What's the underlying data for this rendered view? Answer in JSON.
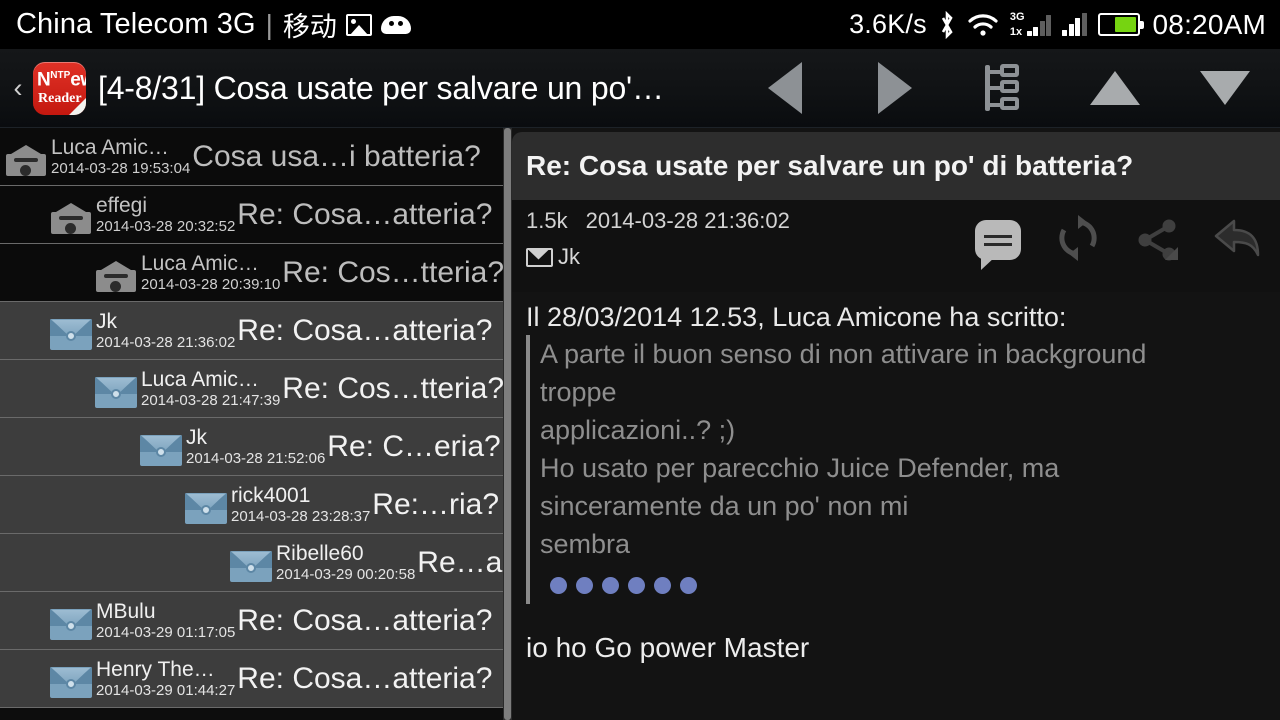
{
  "statusbar": {
    "carrier": "China Telecom 3G",
    "separator": "|",
    "carrier_cn": "移动",
    "picture_icon": "picture-icon",
    "android_icon": "android-icon",
    "speed": "3.6K/s",
    "bluetooth_icon": "bluetooth-icon",
    "wifi_icon": "wifi-icon",
    "net_label_top": "3G",
    "net_label_bottom": "1x",
    "signal_icon": "signal-bars-icon",
    "battery_icon": "battery-icon",
    "time": "08:20AM"
  },
  "actionbar": {
    "back_glyph": "‹",
    "logo": {
      "name": "nntp-news-reader-logo",
      "line1": "N",
      "line1_sup": "NTP",
      "line1_rest": "ews",
      "line2": "Reader"
    },
    "title": "[4-8/31] Cosa usate per salvare un po'…",
    "actions": [
      {
        "name": "previous-message-button",
        "icon": "triangle-left-icon"
      },
      {
        "name": "next-message-button",
        "icon": "triangle-right-icon"
      },
      {
        "name": "thread-tree-button",
        "icon": "thread-tree-icon"
      },
      {
        "name": "scroll-up-button",
        "icon": "triangle-up-icon"
      },
      {
        "name": "scroll-down-button",
        "icon": "triangle-down-icon"
      }
    ]
  },
  "list": {
    "rows": [
      {
        "author": "Luca Amic…",
        "date": "2014-03-28 19:53:04",
        "subject": "Cosa usa…i batteria?",
        "indent": 0,
        "read": true
      },
      {
        "author": "effegi",
        "date": "2014-03-28 20:32:52",
        "subject": "Re: Cosa…atteria?",
        "indent": 1,
        "read": true
      },
      {
        "author": "Luca Amic…",
        "date": "2014-03-28 20:39:10",
        "subject": "Re: Cos…tteria?",
        "indent": 2,
        "read": true
      },
      {
        "author": "Jk",
        "date": "2014-03-28 21:36:02",
        "subject": "Re: Cosa…atteria?",
        "indent": 1,
        "read": false
      },
      {
        "author": "Luca Amic…",
        "date": "2014-03-28 21:47:39",
        "subject": "Re: Cos…tteria?",
        "indent": 2,
        "read": false
      },
      {
        "author": "Jk",
        "date": "2014-03-28 21:52:06",
        "subject": "Re: C…eria?",
        "indent": 3,
        "read": false
      },
      {
        "author": "rick4001",
        "date": "2014-03-28 23:28:37",
        "subject": "Re:…ria?",
        "indent": 4,
        "read": false
      },
      {
        "author": "Ribelle60",
        "date": "2014-03-29 00:20:58",
        "subject": "Re…a?",
        "indent": 5,
        "read": false
      },
      {
        "author": "MBulu",
        "date": "2014-03-29 01:17:05",
        "subject": "Re: Cosa…atteria?",
        "indent": 1,
        "read": false
      },
      {
        "author": "Henry The…",
        "date": "2014-03-29 01:44:27",
        "subject": "Re: Cosa…atteria?",
        "indent": 1,
        "read": false
      }
    ]
  },
  "message": {
    "subject": "Re: Cosa usate per salvare un po' di batteria?",
    "size": "1.5k",
    "date": "2014-03-28 21:36:02",
    "from": "Jk",
    "from_icon": "envelope-icon",
    "actions": [
      {
        "name": "comment-button",
        "icon": "comment-bubble-icon"
      },
      {
        "name": "refresh-button",
        "icon": "refresh-icon"
      },
      {
        "name": "share-button",
        "icon": "share-icon"
      },
      {
        "name": "reply-button",
        "icon": "reply-arrow-icon"
      }
    ],
    "attribution": "Il 28/03/2014 12.53, Luca Amicone ha scritto:",
    "quote_lines": [
      "A parte il buon senso di non attivare in background",
      "troppe",
      "applicazioni..? ;)",
      "Ho usato per parecchio Juice Defender, ma",
      "sinceramente da un po' non mi",
      "sembra"
    ],
    "collapsed_dots": 6,
    "tail_text": "io ho Go power Master"
  },
  "colors": {
    "accent_red": "#d32218",
    "unread_envelope": "#7ba2bd",
    "battery_green": "#76d411",
    "quote_dot": "#6f7fc0",
    "row_unread_bg": "#3d3d3d",
    "row_read_bg": "#0b0b0b"
  }
}
